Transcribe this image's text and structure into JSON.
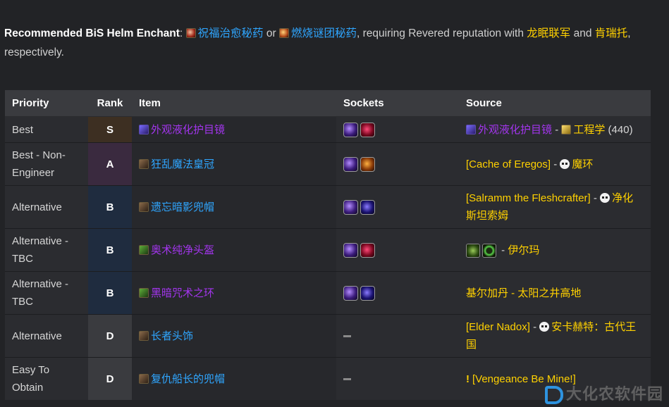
{
  "intro": {
    "lead": "Recommended BiS Helm Enchant",
    "colon": ":",
    "enchant1": "祝福治愈秘药",
    "or": "or",
    "enchant2": "燃烧谜团秘药",
    "mid": ", requiring Revered reputation with",
    "faction1": "龙眠联军",
    "and": "and",
    "faction2": "肯瑞托",
    "tail": ", respectively."
  },
  "table": {
    "headers": [
      "Priority",
      "Rank",
      "Item",
      "Sockets",
      "Source"
    ],
    "rows": [
      {
        "priority": "Best",
        "rank": "S",
        "item": "外观液化护目镜",
        "sockets": [
          "meta",
          "red"
        ],
        "source": {
          "name": "外观液化护目镜",
          "sep": "-",
          "prof": "工程学",
          "skill": "(440)"
        }
      },
      {
        "priority": "Best - Non-Engineer",
        "rank": "A",
        "item": "狂乱魔法皇冠",
        "sockets": [
          "meta",
          "orange"
        ],
        "source": {
          "name": "[Cache of Eregos]",
          "sep": "-",
          "zone": "魔环"
        }
      },
      {
        "priority": "Alternative",
        "rank": "B",
        "item": "遗忘暗影兜帽",
        "sockets": [
          "meta",
          "blue"
        ],
        "source": {
          "name": "[Salramm the Fleshcrafter]",
          "sep": "-",
          "zone": "净化斯坦索姆"
        }
      },
      {
        "priority": "Alternative - TBC",
        "rank": "B",
        "item": "奥术纯净头盔",
        "sockets": [
          "meta",
          "red"
        ],
        "source": {
          "sep": "-",
          "zone": "伊尔玛"
        }
      },
      {
        "priority": "Alternative - TBC",
        "rank": "B",
        "item": "黑暗咒术之环",
        "sockets": [
          "meta",
          "blue"
        ],
        "source": {
          "name": "基尔加丹 - 太阳之井高地"
        }
      },
      {
        "priority": "Alternative",
        "rank": "D",
        "item": "长者头饰",
        "sockets": [],
        "source": {
          "name": "[Elder Nadox]",
          "sep": "-",
          "zone": "安卡赫特：古代王国"
        }
      },
      {
        "priority": "Easy To Obtain",
        "rank": "D",
        "item": "复仇船长的兜帽",
        "sockets": [],
        "source": {
          "name": "[Vengeance Be Mine!]"
        }
      }
    ]
  },
  "watermark": "大化农软件园",
  "colors": {
    "background": "#222326",
    "link_blue": "#2fa6ff",
    "gold": "#ffd100",
    "epic_purple": "#a335ee"
  }
}
